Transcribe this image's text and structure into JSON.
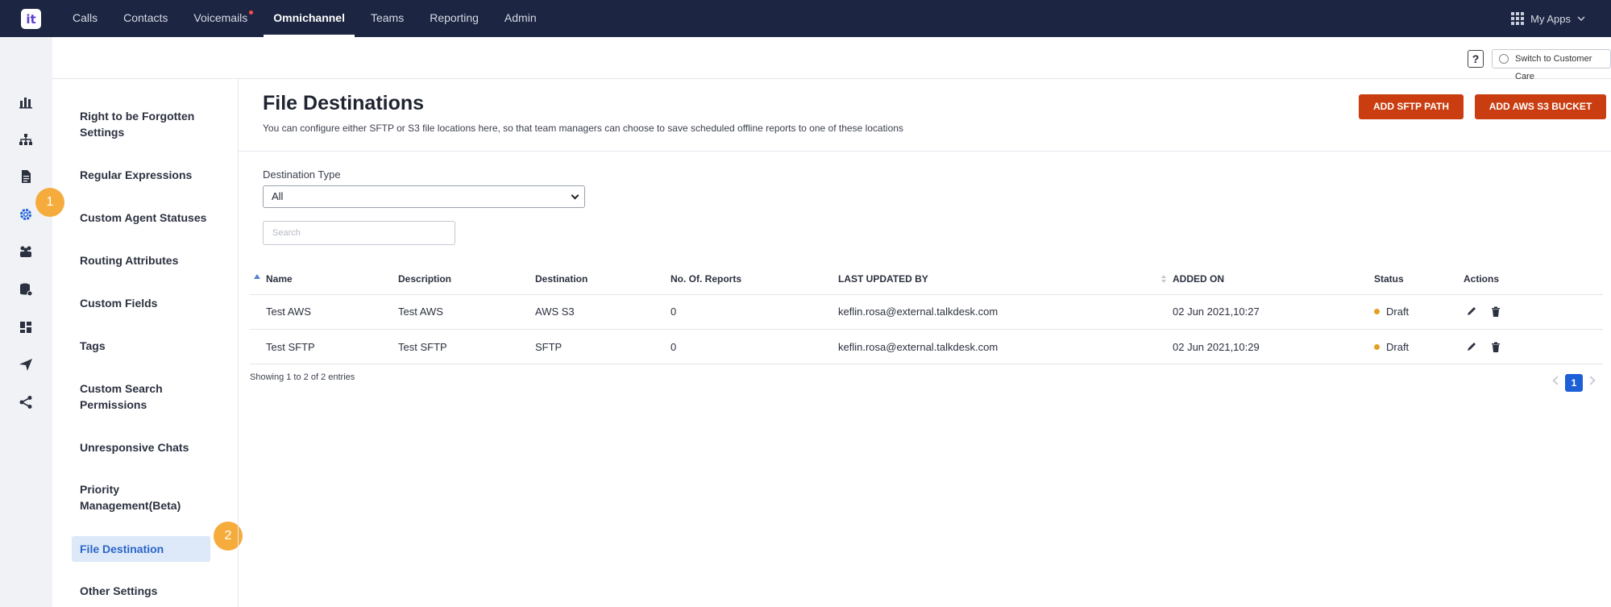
{
  "topnav": {
    "logo": "it",
    "items": [
      {
        "label": "Calls",
        "active": false,
        "dot": false
      },
      {
        "label": "Contacts",
        "active": false,
        "dot": false
      },
      {
        "label": "Voicemails",
        "active": false,
        "dot": true
      },
      {
        "label": "Omnichannel",
        "active": true,
        "dot": false
      },
      {
        "label": "Teams",
        "active": false,
        "dot": false
      },
      {
        "label": "Reporting",
        "active": false,
        "dot": false
      },
      {
        "label": "Admin",
        "active": false,
        "dot": false
      }
    ],
    "myapps_label": "My Apps"
  },
  "rail": {
    "icons": [
      "bar-chart-icon",
      "hierarchy-icon",
      "document-icon",
      "gear-icon",
      "group-icon",
      "database-icon",
      "dashboard-icon",
      "send-icon",
      "share-icon"
    ]
  },
  "steps": {
    "one": "1",
    "two": "2"
  },
  "subheader": {
    "help_label": "?",
    "care_label": "Switch to Customer Care"
  },
  "menu": {
    "items": [
      {
        "label": "Right to be Forgotten Settings"
      },
      {
        "label": "Regular Expressions"
      },
      {
        "label": "Custom Agent Statuses"
      },
      {
        "label": "Routing Attributes"
      },
      {
        "label": "Custom Fields"
      },
      {
        "label": "Tags"
      },
      {
        "label": "Custom Search Permissions"
      },
      {
        "label": "Unresponsive Chats"
      },
      {
        "label": "Priority Management(Beta)"
      },
      {
        "label": "File Destination"
      },
      {
        "label": "Other Settings"
      }
    ],
    "active": "File Destination"
  },
  "page": {
    "title": "File Destinations",
    "subtitle": "You can configure either SFTP or S3 file locations here, so that team managers can choose to save scheduled offline reports to one of these locations",
    "add_sftp_label": "ADD SFTP PATH",
    "add_s3_label": "ADD AWS S3 BUCKET"
  },
  "filters": {
    "destination_type_label": "Destination Type",
    "destination_type_value": "All",
    "search_placeholder": "Search"
  },
  "table": {
    "headers": {
      "name": "Name",
      "description": "Description",
      "destination": "Destination",
      "reports": "No. Of. Reports",
      "updated_by": "LAST UPDATED BY",
      "added_on": "ADDED ON",
      "status": "Status",
      "actions": "Actions"
    },
    "rows": [
      {
        "name": "Test AWS",
        "description": "Test AWS",
        "destination": "AWS S3",
        "reports": "0",
        "updated_by": "keflin.rosa@external.talkdesk.com",
        "added_on": "02 Jun 2021,10:27",
        "status": "Draft"
      },
      {
        "name": "Test SFTP",
        "description": "Test SFTP",
        "destination": "SFTP",
        "reports": "0",
        "updated_by": "keflin.rosa@external.talkdesk.com",
        "added_on": "02 Jun 2021,10:29",
        "status": "Draft"
      }
    ],
    "footer_info": "Showing 1 to 2 of 2 entries",
    "current_page": "1"
  },
  "colors": {
    "topbar": "#1c2541",
    "primary_button": "#c93d10",
    "active_menu_bg": "#dde8f8",
    "active_menu_text": "#2a66c9",
    "draft_status": "#e3a020",
    "step_badge": "#f5ac3d",
    "pager_active": "#1d5fd6"
  }
}
